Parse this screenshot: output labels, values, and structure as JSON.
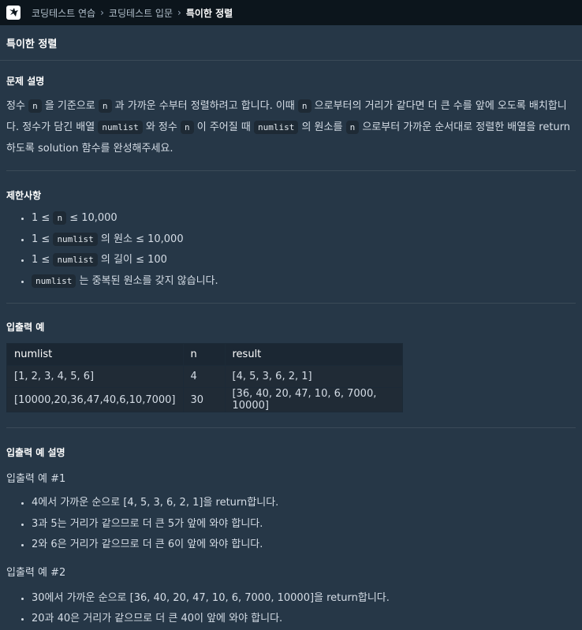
{
  "breadcrumb": {
    "items": [
      "코딩테스트 연습",
      "코딩테스트 입문"
    ],
    "current": "특이한 정렬"
  },
  "problem_title": "특이한 정렬",
  "description": {
    "heading": "문제 설명",
    "p1": "정수 ",
    "c1": "n",
    "p2": " 을 기준으로 ",
    "c2": "n",
    "p3": " 과 가까운 수부터 정렬하려고 합니다. 이때 ",
    "c3": "n",
    "p4": " 으로부터의 거리가 같다면 더 큰 수를 앞에 오도록 배치합니다. 정수가 담긴 배열 ",
    "c4": "numlist",
    "p5": " 와 정수 ",
    "c5": "n",
    "p6": " 이 주어질 때 ",
    "c6": "numlist",
    "p7": " 의 원소를 ",
    "c7": "n",
    "p8": " 으로부터 가까운 순서대로 정렬한 배열을 return하도록 solution 함수를 완성해주세요."
  },
  "constraints": {
    "heading": "제한사항",
    "items": [
      {
        "pre": "1 ≤ ",
        "code": "n",
        "post": " ≤ 10,000"
      },
      {
        "pre": "1 ≤ ",
        "code": "numlist",
        "post": " 의 원소 ≤ 10,000"
      },
      {
        "pre": "1 ≤ ",
        "code": "numlist",
        "post": " 의 길이 ≤ 100"
      },
      {
        "pre": "",
        "code": "numlist",
        "post": " 는 중복된 원소를 갖지 않습니다."
      }
    ]
  },
  "examples": {
    "heading": "입출력 예",
    "columns": [
      "numlist",
      "n",
      "result"
    ],
    "rows": [
      [
        "[1, 2, 3, 4, 5, 6]",
        "4",
        "[4, 5, 3, 6, 2, 1]"
      ],
      [
        "[10000,20,36,47,40,6,10,7000]",
        "30",
        "[36, 40, 20, 47, 10, 6, 7000, 10000]"
      ]
    ]
  },
  "explanation": {
    "heading": "입출력 예 설명",
    "ex1_label": "입출력 예 #1",
    "ex1_items": [
      "4에서 가까운 순으로 [4, 5, 3, 6, 2, 1]을 return합니다.",
      "3과 5는 거리가 같으므로 더 큰 5가 앞에 와야 합니다.",
      "2와 6은 거리가 같으므로 더 큰 6이 앞에 와야 합니다."
    ],
    "ex2_label": "입출력 예 #2",
    "ex2_items": [
      "30에서 가까운 순으로 [36, 40, 20, 47, 10, 6, 7000, 10000]을 return합니다.",
      "20과 40은 거리가 같으므로 더 큰 40이 앞에 와야 합니다."
    ]
  },
  "icons": {
    "logo": "programmers-logo-icon",
    "separator": "chevron-right-icon"
  }
}
